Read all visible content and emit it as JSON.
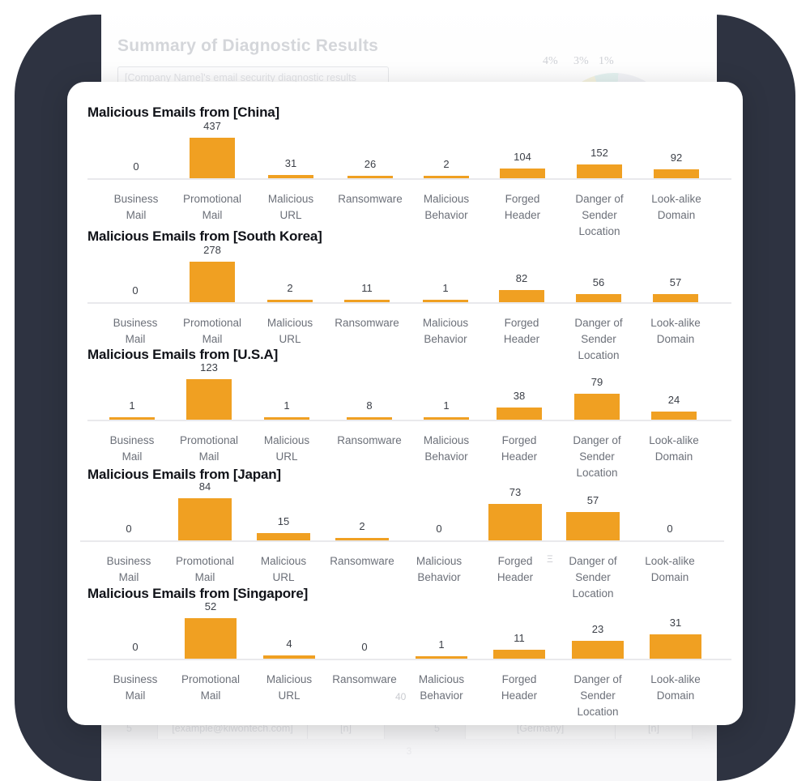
{
  "background_document": {
    "title": "Summary of Diagnostic Results",
    "subtitle_box_text": "[Company Name]'s email security diagnostic results",
    "pie_percent_labels": [
      "4%",
      "3%",
      "1%"
    ],
    "table_row": [
      "5",
      "[example@kiwontech.com]",
      "[n]",
      "5",
      "[Germany]",
      "[n]"
    ],
    "page_number": "3"
  },
  "theme": {
    "bar_color": "#f0a022",
    "axis_color": "#e9e9ec",
    "backdrop_color": "#2e3341",
    "card_color": "#ffffff",
    "title_color": "#111319",
    "label_color": "#6c7079",
    "value_color": "#3b3f47"
  },
  "categories": [
    "Business\nMail",
    "Promotional\nMail",
    "Malicious\nURL",
    "Ransomware",
    "Malicious\nBehavior",
    "Forged\nHeader",
    "Danger of\nSender\nLocation",
    "Look-alike\nDomain"
  ],
  "artifacts": [
    {
      "text": "Ξ",
      "chart": 3,
      "note": "stray glyph near Forged Header"
    },
    {
      "text": "40",
      "chart": 4,
      "note": "stray axis number near Ransomware"
    }
  ],
  "chart_data": [
    {
      "type": "bar",
      "title": "Malicious Emails from [China]",
      "categories": [
        "Business Mail",
        "Promotional Mail",
        "Malicious URL",
        "Ransomware",
        "Malicious Behavior",
        "Forged Header",
        "Danger of Sender Location",
        "Look-alike Domain"
      ],
      "values": [
        0,
        437,
        31,
        26,
        2,
        104,
        152,
        92
      ],
      "xlabel": "",
      "ylabel": "",
      "ylim": [
        0,
        437
      ],
      "grid": false,
      "legend": false
    },
    {
      "type": "bar",
      "title": "Malicious Emails from [South Korea]",
      "categories": [
        "Business Mail",
        "Promotional Mail",
        "Malicious URL",
        "Ransomware",
        "Malicious Behavior",
        "Forged Header",
        "Danger of Sender Location",
        "Look-alike Domain"
      ],
      "values": [
        0,
        278,
        2,
        11,
        1,
        82,
        56,
        57
      ],
      "xlabel": "",
      "ylabel": "",
      "ylim": [
        0,
        278
      ],
      "grid": false,
      "legend": false
    },
    {
      "type": "bar",
      "title": "Malicious Emails from [U.S.A]",
      "categories": [
        "Business Mail",
        "Promotional Mail",
        "Malicious URL",
        "Ransomware",
        "Malicious Behavior",
        "Forged Header",
        "Danger of Sender Location",
        "Look-alike Domain"
      ],
      "values": [
        1,
        123,
        1,
        8,
        1,
        38,
        79,
        24
      ],
      "xlabel": "",
      "ylabel": "",
      "ylim": [
        0,
        123
      ],
      "grid": false,
      "legend": false
    },
    {
      "type": "bar",
      "title": "Malicious Emails from [Japan]",
      "categories": [
        "Business Mail",
        "Promotional Mail",
        "Malicious URL",
        "Ransomware",
        "Malicious Behavior",
        "Forged Header",
        "Danger of Sender Location",
        "Look-alike Domain"
      ],
      "values": [
        0,
        84,
        15,
        2,
        0,
        73,
        57,
        0
      ],
      "xlabel": "",
      "ylabel": "",
      "ylim": [
        0,
        84
      ],
      "grid": false,
      "legend": false
    },
    {
      "type": "bar",
      "title": "Malicious Emails from [Singapore]",
      "categories": [
        "Business Mail",
        "Promotional Mail",
        "Malicious URL",
        "Ransomware",
        "Malicious Behavior",
        "Forged Header",
        "Danger of Sender Location",
        "Look-alike Domain"
      ],
      "values": [
        0,
        52,
        4,
        0,
        1,
        11,
        23,
        31
      ],
      "xlabel": "",
      "ylabel": "",
      "ylim": [
        0,
        52
      ],
      "grid": false,
      "legend": false
    }
  ]
}
